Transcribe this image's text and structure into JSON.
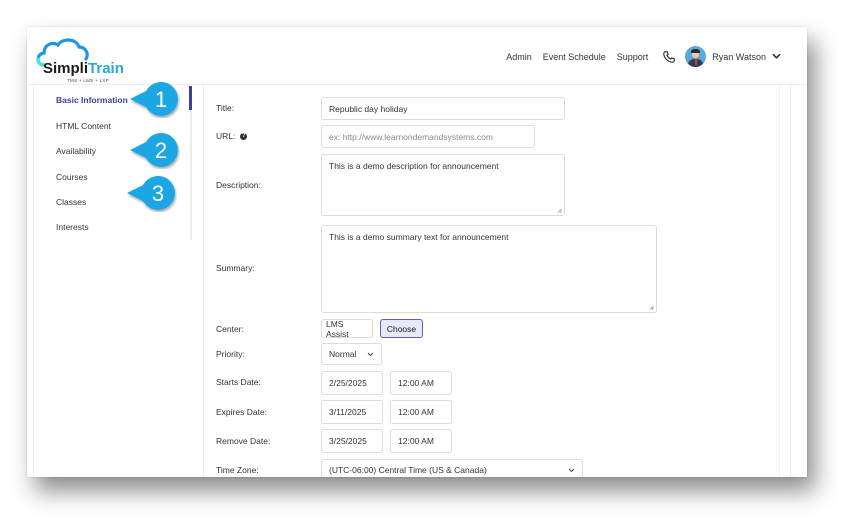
{
  "brand": {
    "name_part1": "Simpli",
    "name_part2": "Train",
    "tagline": "TMS + LMS + LXP"
  },
  "topnav": {
    "links": [
      "Admin",
      "Event Schedule",
      "Support"
    ],
    "user_name": "Ryan Watson"
  },
  "sidebar": {
    "items": [
      {
        "label": "Basic Information",
        "active": true
      },
      {
        "label": "HTML Content"
      },
      {
        "label": "Availability"
      },
      {
        "label": "Courses"
      },
      {
        "label": "Classes"
      },
      {
        "label": "Interests"
      }
    ]
  },
  "callouts": [
    "1",
    "2",
    "3"
  ],
  "form": {
    "title_label": "Title:",
    "title_value": "Republic day holiday",
    "url_label": "URL:",
    "url_placeholder": "ex: http://www.learnondemandsystems.com",
    "description_label": "Description:",
    "description_value": "This is a demo description for announcement",
    "summary_label": "Summary:",
    "summary_value": "This is a demo summary text for announcement",
    "center_label": "Center:",
    "center_value": "LMS Assist",
    "choose_label": "Choose",
    "priority_label": "Priority:",
    "priority_value": "Normal",
    "starts_label": "Starts Date:",
    "starts_date": "2/25/2025",
    "starts_time": "12:00 AM",
    "expires_label": "Expires Date:",
    "expires_date": "3/11/2025",
    "expires_time": "12:00 AM",
    "remove_label": "Remove Date:",
    "remove_date": "3/25/2025",
    "remove_time": "12:00 AM",
    "timezone_label": "Time Zone:",
    "timezone_value": "(UTC-06:00) Central Time (US & Canada)"
  },
  "colors": {
    "accent": "#3b3fa0",
    "callout": "#1ea7e4",
    "brand_blue": "#26a9e0"
  }
}
